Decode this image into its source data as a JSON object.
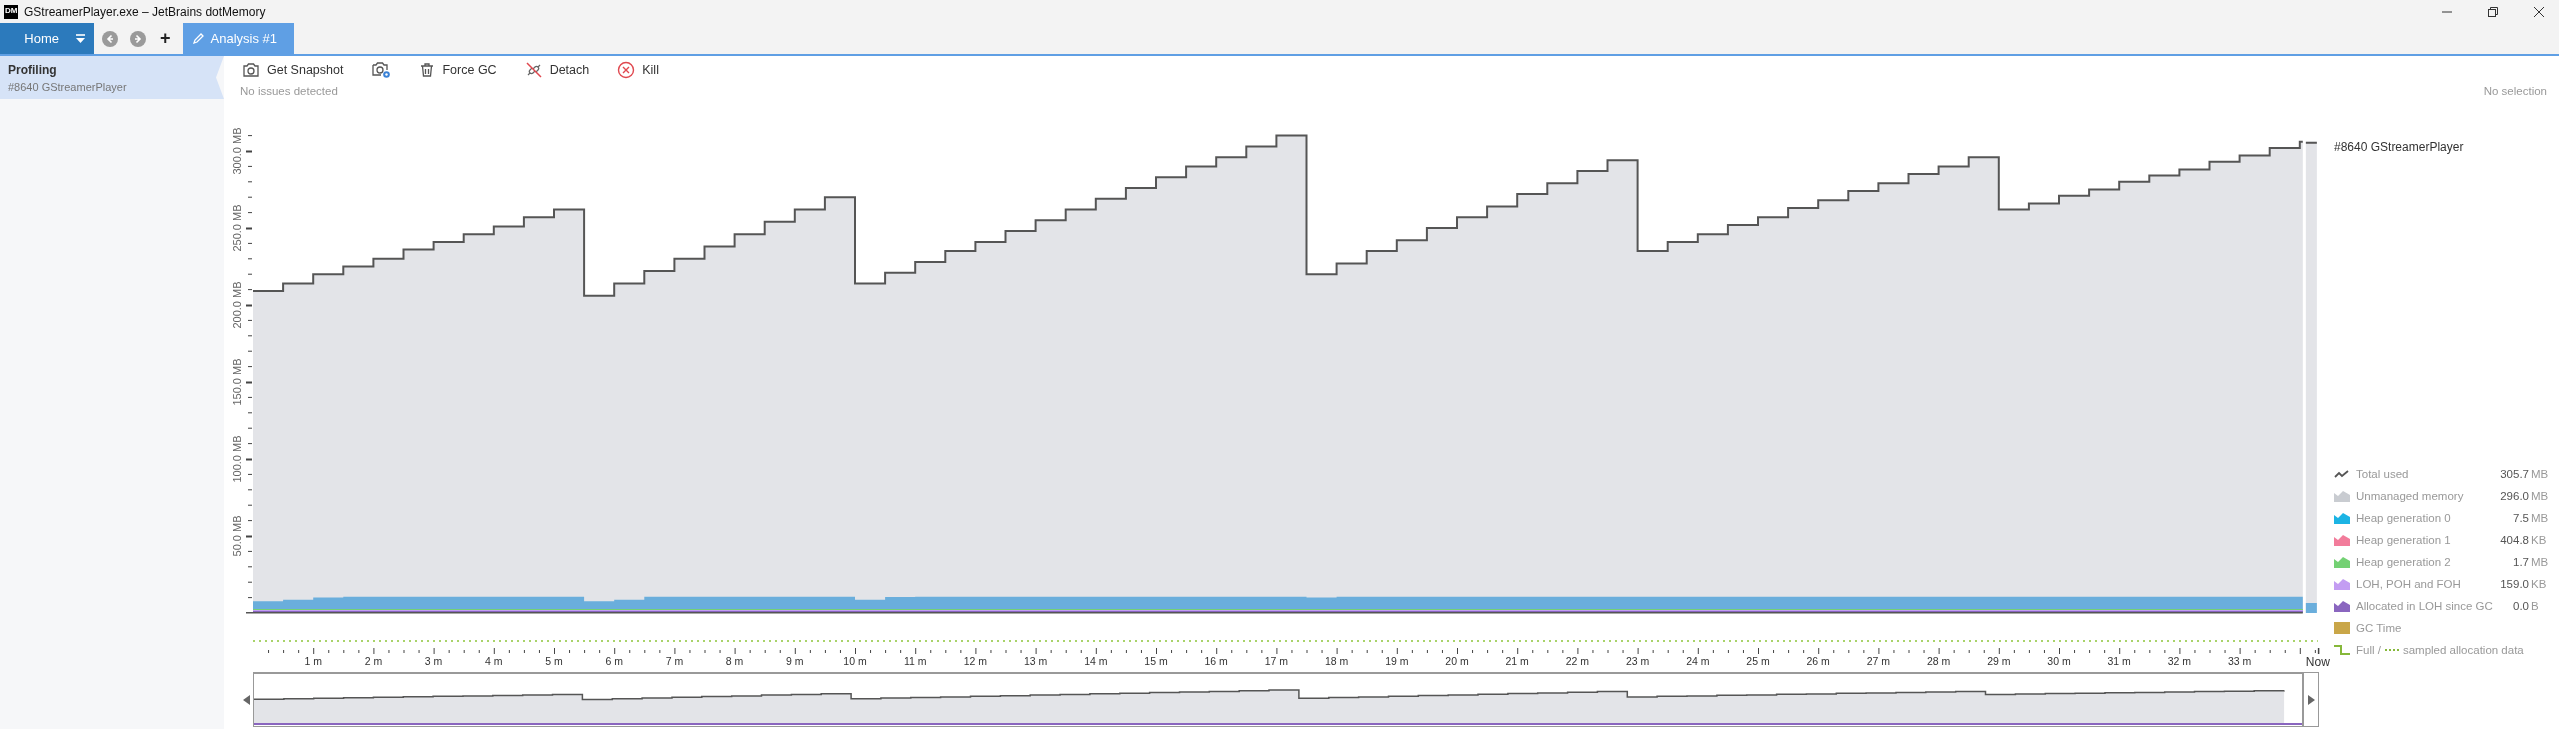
{
  "window": {
    "title": "GStreamerPlayer.exe – JetBrains dotMemory",
    "app_badge": "DM"
  },
  "tabs": [
    {
      "label": "Home",
      "kind": "home",
      "selected": false
    },
    {
      "label": "Analysis #1",
      "kind": "doc",
      "selected": true
    }
  ],
  "new_tab": "+",
  "sidebar": {
    "items": [
      {
        "title": "Profiling",
        "subtitle": "#8640 GStreamerPlayer",
        "selected": true
      }
    ]
  },
  "toolbar": [
    {
      "label": "Get Snapshot",
      "kind": "labeled"
    },
    {
      "kind": "icon-only"
    },
    {
      "label": "Force GC",
      "kind": "labeled"
    },
    {
      "label": "Detach",
      "kind": "labeled"
    },
    {
      "label": "Kill",
      "kind": "labeled"
    }
  ],
  "status": "No issues detected",
  "selection": "No selection",
  "process": "#8640 GStreamerPlayer",
  "chart": {
    "y_labels": [
      "50.0 MB",
      "100.0 MB",
      "150.0 MB",
      "200.0 MB",
      "250.0 MB",
      "300.0 MB"
    ],
    "x_labels": [
      "1 m",
      "2 m",
      "3 m",
      "4 m",
      "5 m",
      "6 m",
      "7 m",
      "8 m",
      "9 m",
      "10 m",
      "11 m",
      "12 m",
      "13 m",
      "14 m",
      "15 m",
      "16 m",
      "17 m",
      "18 m",
      "19 m",
      "20 m",
      "21 m",
      "22 m",
      "23 m",
      "24 m",
      "25 m",
      "26 m",
      "27 m",
      "28 m",
      "29 m",
      "30 m",
      "31 m",
      "32 m",
      "33 m"
    ],
    "now_label": "Now"
  },
  "legend": [
    {
      "label": "Total used",
      "value": "305.7",
      "unit": "MB",
      "kind": "line",
      "color": "#555555"
    },
    {
      "label": "Unmanaged memory",
      "value": "296.0",
      "unit": "MB",
      "kind": "area",
      "color": "#c9ccd1"
    },
    {
      "label": "Heap generation 0",
      "value": "7.5",
      "unit": "MB",
      "kind": "area",
      "color": "#1cb4e4"
    },
    {
      "label": "Heap generation 1",
      "value": "404.8",
      "unit": "KB",
      "kind": "area",
      "color": "#f27c9b"
    },
    {
      "label": "Heap generation 2",
      "value": "1.7",
      "unit": "MB",
      "kind": "area",
      "color": "#74d174"
    },
    {
      "label": "LOH, POH and FOH",
      "value": "159.0",
      "unit": "KB",
      "kind": "area",
      "color": "#c39df2"
    },
    {
      "label": "Allocated in LOH since GC",
      "value": "0.0",
      "unit": "B",
      "kind": "area",
      "color": "#8a66bf"
    },
    {
      "label": "GC Time",
      "kind": "block",
      "color": "#c9a648"
    },
    {
      "label": "Full /",
      "label2": "sampled allocation data",
      "kind": "step",
      "color": "#86b83a"
    }
  ]
}
